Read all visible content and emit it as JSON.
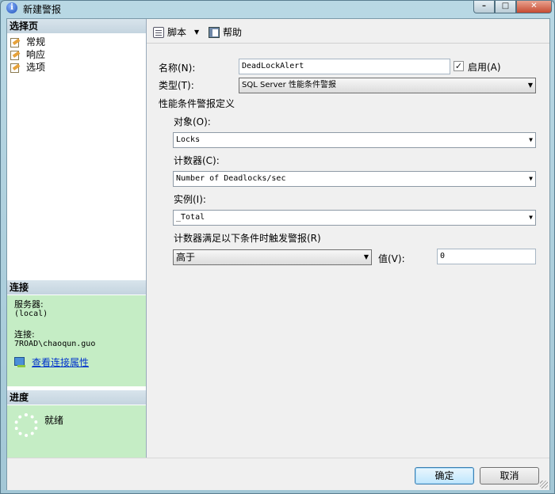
{
  "window": {
    "title": "新建警报"
  },
  "sidebar": {
    "select_page_header": "选择页",
    "pages": [
      {
        "label": "常规"
      },
      {
        "label": "响应"
      },
      {
        "label": "选项"
      }
    ],
    "connection": {
      "header": "连接",
      "server_label": "服务器:",
      "server_value": "(local)",
      "connection_label": "连接:",
      "connection_value": "7ROAD\\chaoqun.guo",
      "view_props_link": "查看连接属性"
    },
    "progress": {
      "header": "进度",
      "status": "就绪"
    }
  },
  "toolbar": {
    "script_label": "脚本",
    "help_label": "帮助"
  },
  "form": {
    "name_label": "名称(N):",
    "name_value": "DeadLockAlert",
    "enabled_label": "启用(A)",
    "enabled_checked": "✓",
    "type_label": "类型(T):",
    "type_value": "SQL Server 性能条件警报",
    "perf_def_label": "性能条件警报定义",
    "object_label": "对象(O):",
    "object_value": "Locks",
    "counter_label": "计数器(C):",
    "counter_value": "Number of Deadlocks/sec",
    "instance_label": "实例(I):",
    "instance_value": "_Total",
    "condition_label": "计数器满足以下条件时触发警报(R)",
    "condition_value": "高于",
    "value_label": "值(V):",
    "value_value": "0"
  },
  "buttons": {
    "ok": "确定",
    "cancel": "取消"
  },
  "icons": {
    "app": "info-icon",
    "page": "page-edit-icon",
    "script": "script-icon",
    "help": "help-icon",
    "connection": "connection-icon",
    "progress": "spinner-icon"
  }
}
